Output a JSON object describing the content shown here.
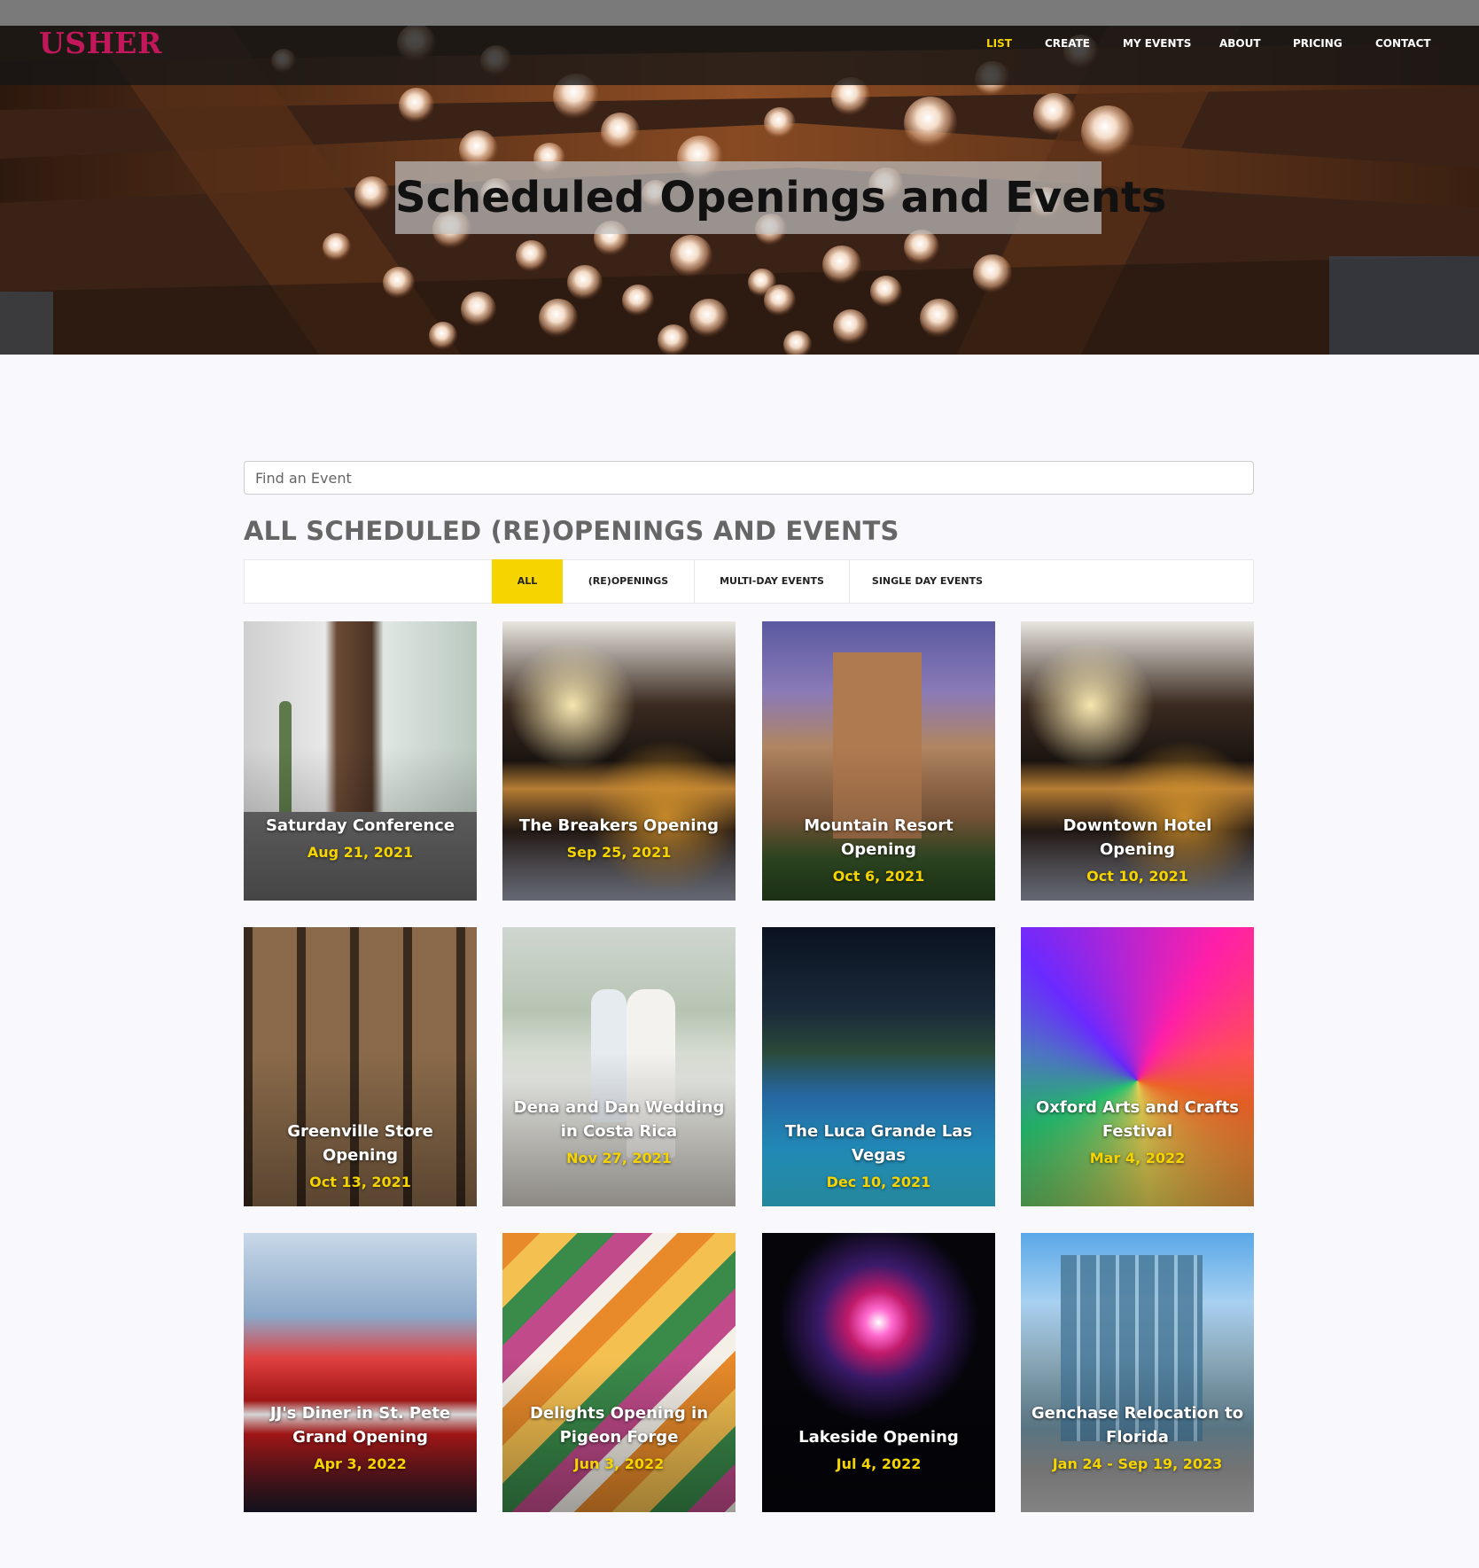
{
  "brand": {
    "logo": "USHER",
    "logo_color": "#c2185b",
    "accent": "#f5d400"
  },
  "nav": {
    "items": [
      {
        "label": "LIST",
        "active": true
      },
      {
        "label": "CREATE",
        "active": false
      },
      {
        "label": "MY EVENTS",
        "active": false
      },
      {
        "label": "ABOUT",
        "active": false
      },
      {
        "label": "PRICING",
        "active": false
      },
      {
        "label": "CONTACT",
        "active": false
      }
    ]
  },
  "hero": {
    "title": "Scheduled Openings and Events",
    "background": "chandelier-bulbs-wood-ceiling"
  },
  "search": {
    "placeholder": "Find an Event",
    "value": ""
  },
  "section": {
    "title": "ALL SCHEDULED (RE)OPENINGS AND EVENTS"
  },
  "filters": {
    "tabs": [
      {
        "label": "ALL",
        "active": true
      },
      {
        "label": "(RE)OPENINGS",
        "active": false
      },
      {
        "label": "MULTI-DAY EVENTS",
        "active": false
      },
      {
        "label": "SINGLE DAY EVENTS",
        "active": false
      }
    ]
  },
  "events": [
    {
      "title": "Saturday Conference",
      "date": "Aug 21, 2021",
      "image": "cozy-window-nook-photo"
    },
    {
      "title": "The Breakers Opening",
      "date": "Sep 25, 2021",
      "image": "string-lights-bokeh-photo"
    },
    {
      "title": "Mountain Resort Opening",
      "date": "Oct 6, 2021",
      "image": "resort-hotel-night-photo"
    },
    {
      "title": "Downtown Hotel Opening",
      "date": "Oct 10, 2021",
      "image": "string-lights-bokeh-photo"
    },
    {
      "title": "Greenville Store Opening",
      "date": "Oct 13, 2021",
      "image": "store-shelves-bottles-photo"
    },
    {
      "title": "Dena and Dan Wedding in Costa Rica",
      "date": "Nov 27, 2021",
      "image": "beach-wedding-couple-photo"
    },
    {
      "title": "The Luca Grande Las Vegas",
      "date": "Dec 10, 2021",
      "image": "pool-at-night-photo"
    },
    {
      "title": "Oxford Arts and Crafts Festival",
      "date": "Mar 4, 2022",
      "image": "colorful-paper-yarn-photo"
    },
    {
      "title": "JJ's Diner in St. Pete Grand Opening",
      "date": "Apr 3, 2022",
      "image": "retro-diner-booths-photo"
    },
    {
      "title": "Delights Opening in Pigeon Forge",
      "date": "Jun 3, 2022",
      "image": "macarons-rows-photo"
    },
    {
      "title": "Lakeside Opening",
      "date": "Jul 4, 2022",
      "image": "fireworks-night-photo"
    },
    {
      "title": "Genchase Relocation to Florida",
      "date": "Jan 24 - Sep 19, 2023",
      "image": "glass-office-building-photo"
    }
  ]
}
